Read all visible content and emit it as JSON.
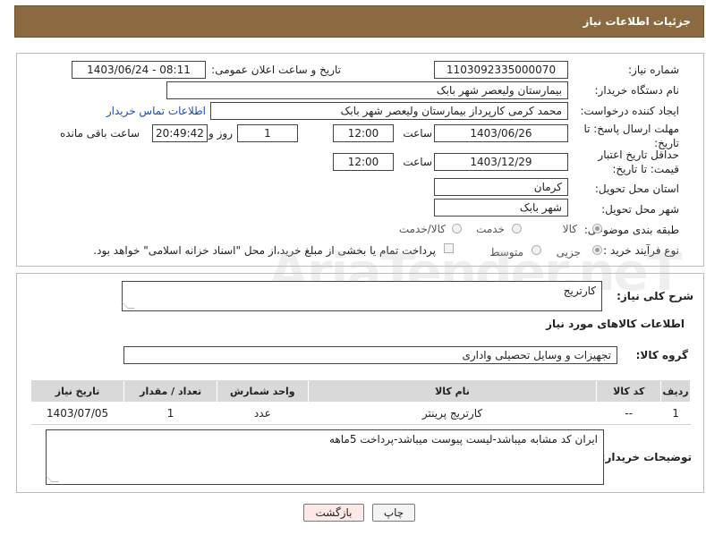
{
  "header": {
    "title": "جزئیات اطلاعات نیاز"
  },
  "form": {
    "need_number_label": "شماره نیاز:",
    "need_number": "1103092335000070",
    "announce_label": "تاریخ و ساعت اعلان عمومی:",
    "announce_value": "1403/06/24 - 08:11",
    "buyer_org_label": "نام دستگاه خریدار:",
    "buyer_org": "بیمارستان ولیعصر شهر بابک",
    "creator_label": "ایجاد کننده درخواست:",
    "creator": "محمد  کرمی  کارپرداز  بیمارستان ولیعصر شهر بابک",
    "contact_link": "اطلاعات تماس خریدار",
    "deadline_label": "مهلت ارسال پاسخ: تا تاریخ:",
    "deadline_date": "1403/06/26",
    "time_label": "ساعت",
    "deadline_time": "12:00",
    "days_value": "1",
    "days_label": "روز و",
    "remaining_time": "20:49:42",
    "remaining_label": "ساعت باقی مانده",
    "price_validity_label": "حداقل تاریخ اعتبار قیمت: تا تاریخ:",
    "price_validity_date": "1403/12/29",
    "price_validity_time": "12:00",
    "province_label": "استان محل تحویل:",
    "province": "کرمان",
    "city_label": "شهر محل تحویل:",
    "city": "شهر بابک",
    "category_label": "طبقه بندی موضوعی:",
    "category_options": [
      "کالا",
      "خدمت",
      "کالا/خدمت"
    ],
    "category_selected": "کالا",
    "process_label": "نوع فرآیند خرید :",
    "process_options": [
      "جزیی",
      "متوسط"
    ],
    "process_selected": "جزیی",
    "payment_note": "پرداخت تمام یا بخشی از مبلغ خرید،از محل \"اسناد خزانه اسلامی\" خواهد بود."
  },
  "description": {
    "label": "شرح کلی نیاز:",
    "value": "کارتریج"
  },
  "goods": {
    "section_title": "اطلاعات کالاهای مورد نیاز",
    "group_label": "گروه کالا:",
    "group_value": "تجهیزات و وسایل تحصیلی واداری",
    "columns": [
      "ردیف",
      "کد کالا",
      "نام کالا",
      "واحد شمارش",
      "تعداد / مقدار",
      "تاریخ نیاز"
    ],
    "rows": [
      [
        "1",
        "--",
        "کارتریج پرینتر",
        "عدد",
        "1",
        "1403/07/05"
      ]
    ]
  },
  "buyer_notes": {
    "label": "توضیحات خریدار:",
    "value": "ایران کد مشابه میباشد-لیست پیوست میباشد-پرداخت 5ماهه"
  },
  "buttons": {
    "print": "چاپ",
    "back": "بازگشت"
  },
  "colors": {
    "header_bg": "#8b6a42",
    "link": "#1a4fb5",
    "back_button_bg": "#fde8e8"
  }
}
